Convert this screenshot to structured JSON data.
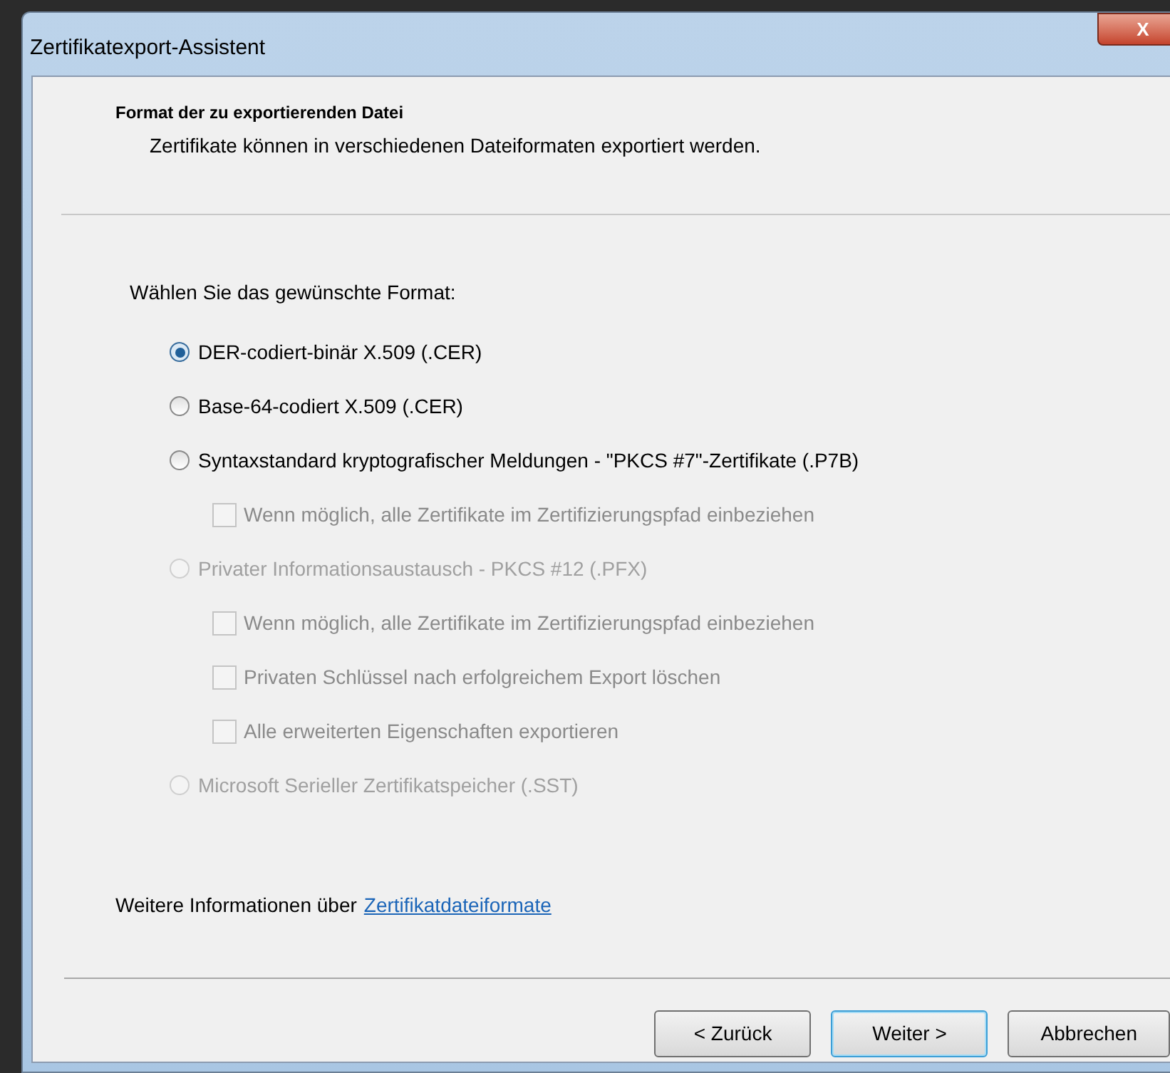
{
  "window": {
    "title": "Zertifikatexport-Assistent",
    "close": "X"
  },
  "header": {
    "title": "Format der zu exportierenden Datei",
    "subtitle": "Zertifikate können in verschiedenen Dateiformaten exportiert werden."
  },
  "prompt": "Wählen Sie das gewünschte Format:",
  "formats": [
    {
      "label": "DER-codiert-binär X.509 (.CER)",
      "selected": true,
      "disabled": false
    },
    {
      "label": "Base-64-codiert X.509 (.CER)",
      "selected": false,
      "disabled": false
    },
    {
      "label": "Syntaxstandard kryptografischer Meldungen - \"PKCS #7\"-Zertifikate (.P7B)",
      "selected": false,
      "disabled": false,
      "options": [
        {
          "label": "Wenn möglich, alle Zertifikate im Zertifizierungspfad einbeziehen",
          "checked": false,
          "disabled": true
        }
      ]
    },
    {
      "label": "Privater Informationsaustausch - PKCS #12 (.PFX)",
      "selected": false,
      "disabled": true,
      "options": [
        {
          "label": "Wenn möglich, alle Zertifikate im Zertifizierungspfad einbeziehen",
          "checked": false,
          "disabled": true
        },
        {
          "label": "Privaten Schlüssel nach erfolgreichem Export löschen",
          "checked": false,
          "disabled": true
        },
        {
          "label": "Alle erweiterten Eigenschaften exportieren",
          "checked": false,
          "disabled": true
        }
      ]
    },
    {
      "label": "Microsoft Serieller Zertifikatspeicher (.SST)",
      "selected": false,
      "disabled": true
    }
  ],
  "info": {
    "text": "Weitere Informationen über",
    "link": "Zertifikatdateiformate"
  },
  "buttons": [
    {
      "label": "< Zurück",
      "default": false
    },
    {
      "label": "Weiter >",
      "default": true
    },
    {
      "label": "Abbrechen",
      "default": false
    }
  ]
}
